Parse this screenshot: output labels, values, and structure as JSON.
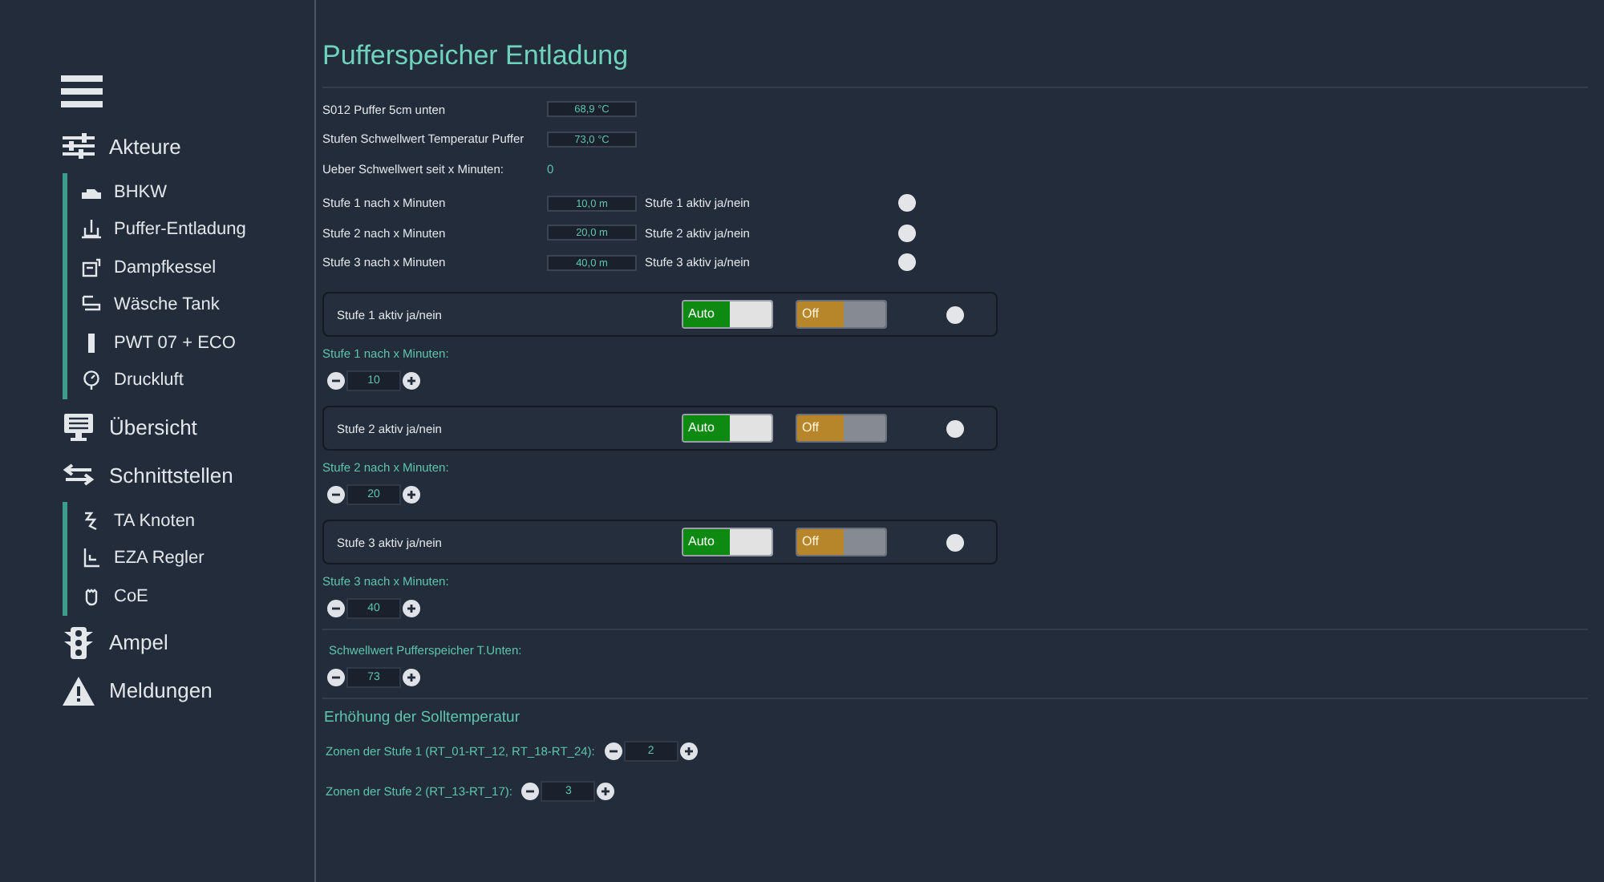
{
  "sidebar": {
    "items": [
      {
        "label": "Akteure",
        "kind": "group",
        "children": [
          {
            "label": "BHKW"
          },
          {
            "label": "Puffer-Entladung"
          },
          {
            "label": "Dampfkessel"
          },
          {
            "label": "Wäsche Tank"
          },
          {
            "label": "PWT 07 + ECO"
          },
          {
            "label": "Druckluft"
          }
        ]
      },
      {
        "label": "Übersicht",
        "kind": "single"
      },
      {
        "label": "Schnittstellen",
        "kind": "group",
        "children": [
          {
            "label": "TA Knoten"
          },
          {
            "label": "EZA Regler"
          },
          {
            "label": "CoE"
          }
        ]
      },
      {
        "label": "Ampel",
        "kind": "single"
      },
      {
        "label": "Meldungen",
        "kind": "single"
      }
    ]
  },
  "title": "Pufferspeicher Entladung",
  "readings": [
    {
      "label": "S012 Puffer 5cm unten",
      "value": "68,9 °C",
      "kind": "field"
    },
    {
      "label": "Stufen Schwellwert Temperatur Puffer",
      "value": "73,0 °C",
      "kind": "field"
    },
    {
      "label": "Ueber Schwellwert seit x Minuten:",
      "value": "0",
      "kind": "plain"
    }
  ],
  "stage_rows": [
    {
      "label": "Stufe 1 nach x Minuten",
      "value": "10,0 m",
      "active_label": "Stufe 1 aktiv ja/nein"
    },
    {
      "label": "Stufe 2 nach x Minuten",
      "value": "20,0 m",
      "active_label": "Stufe 2 aktiv ja/nein"
    },
    {
      "label": "Stufe 3 nach x Minuten",
      "value": "40,0 m",
      "active_label": "Stufe 3 aktiv ja/nein"
    }
  ],
  "stage_cards": [
    {
      "label": "Stufe 1 aktiv ja/nein",
      "auto": {
        "label": "Auto",
        "on": true
      },
      "off": {
        "label": "Off",
        "on": false
      },
      "minutes_label": "Stufe 1 nach x Minuten:",
      "minutes": "10"
    },
    {
      "label": "Stufe 2 aktiv ja/nein",
      "auto": {
        "label": "Auto",
        "on": true
      },
      "off": {
        "label": "Off",
        "on": false
      },
      "minutes_label": "Stufe 2 nach x Minuten:",
      "minutes": "20"
    },
    {
      "label": "Stufe 3 aktiv ja/nein",
      "auto": {
        "label": "Auto",
        "on": true
      },
      "off": {
        "label": "Off",
        "on": false
      },
      "minutes_label": "Stufe 3 nach x Minuten:",
      "minutes": "40"
    }
  ],
  "threshold": {
    "label": "Schwellwert Pufferspeicher T.Unten:",
    "value": "73"
  },
  "setpoint": {
    "title": "Erhöhung der Solltemperatur",
    "zones": [
      {
        "label": "Zonen der Stufe 1 (RT_01-RT_12, RT_18-RT_24):",
        "value": "2"
      },
      {
        "label": "Zonen der Stufe 2 (RT_13-RT_17):",
        "value": "3"
      }
    ]
  }
}
